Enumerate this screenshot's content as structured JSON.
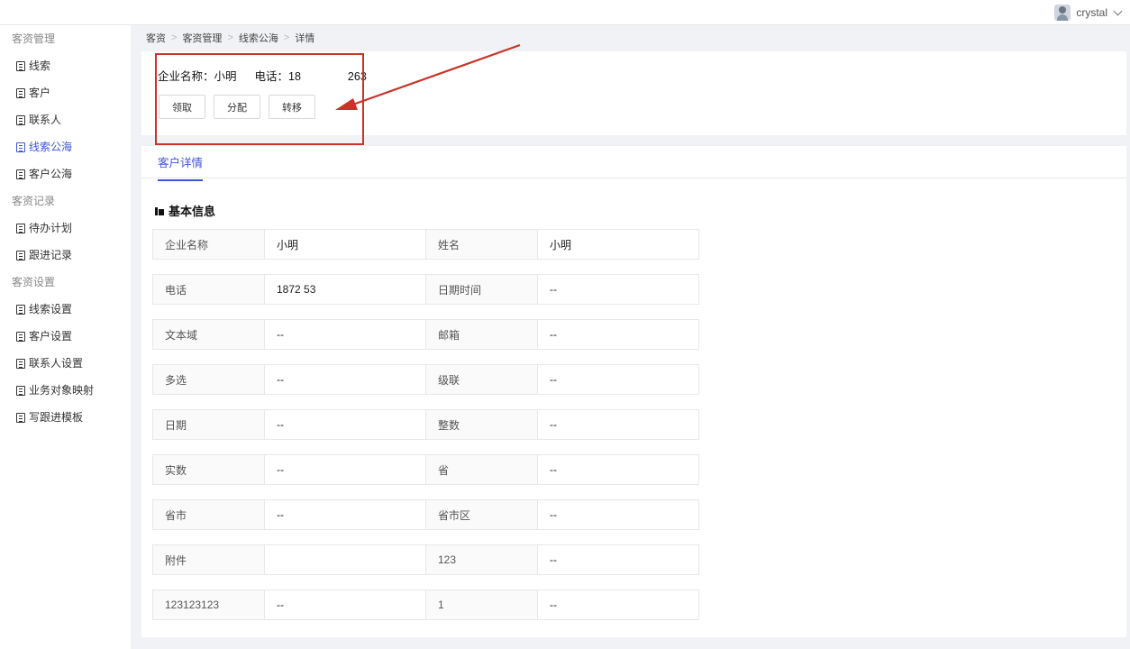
{
  "user": {
    "name": "crystal"
  },
  "sidebar": {
    "groups": [
      {
        "title": "客资管理",
        "items": [
          {
            "label": "线索",
            "active": false
          },
          {
            "label": "客户",
            "active": false
          },
          {
            "label": "联系人",
            "active": false
          },
          {
            "label": "线索公海",
            "active": true
          },
          {
            "label": "客户公海",
            "active": false
          }
        ]
      },
      {
        "title": "客资记录",
        "items": [
          {
            "label": "待办计划",
            "active": false
          },
          {
            "label": "跟进记录",
            "active": false
          }
        ]
      },
      {
        "title": "客资设置",
        "items": [
          {
            "label": "线索设置",
            "active": false
          },
          {
            "label": "客户设置",
            "active": false
          },
          {
            "label": "联系人设置",
            "active": false
          },
          {
            "label": "业务对象映射",
            "active": false
          },
          {
            "label": "写跟进模板",
            "active": false
          }
        ]
      }
    ]
  },
  "breadcrumb": [
    "客资",
    "客资管理",
    "线索公海",
    "详情"
  ],
  "header": {
    "company_label": "企业名称：小明",
    "phone_label": "电话：18",
    "phone_tail": "263",
    "buttons": [
      "领取",
      "分配",
      "转移"
    ]
  },
  "tabs": {
    "active": "客户详情"
  },
  "section": {
    "title": "基本信息"
  },
  "fields": [
    {
      "l1": "企业名称",
      "v1": "小明",
      "l2": "姓名",
      "v2": "小明"
    },
    {
      "l1": "电话",
      "v1": "1872        53",
      "l2": "日期时间",
      "v2": "--"
    },
    {
      "l1": "文本域",
      "v1": "--",
      "l2": "邮箱",
      "v2": "--"
    },
    {
      "l1": "多选",
      "v1": "--",
      "l2": "级联",
      "v2": "--"
    },
    {
      "l1": "日期",
      "v1": "--",
      "l2": "整数",
      "v2": "--"
    },
    {
      "l1": "实数",
      "v1": "--",
      "l2": "省",
      "v2": "--"
    },
    {
      "l1": "省市",
      "v1": "--",
      "l2": "省市区",
      "v2": "--"
    },
    {
      "l1": "附件",
      "v1": "",
      "l2": "123",
      "v2": "--"
    },
    {
      "l1": "123123123",
      "v1": "--",
      "l2": "1",
      "v2": "--"
    }
  ],
  "colors": {
    "accent": "#3f55d4",
    "annotation": "#c8342a"
  }
}
